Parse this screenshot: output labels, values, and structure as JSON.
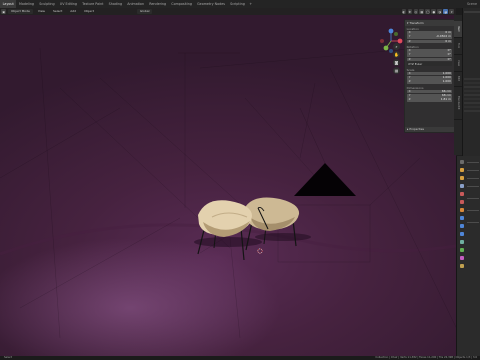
{
  "topbar": {
    "tabs": [
      "Layout",
      "Modeling",
      "Sculpting",
      "UV Editing",
      "Texture Paint",
      "Shading",
      "Animation",
      "Rendering",
      "Compositing",
      "Geometry Nodes",
      "Scripting"
    ],
    "active_tab": "Layout",
    "add_label": "+",
    "scene_label": "Scene"
  },
  "viewport_header": {
    "mode_select": "Object Mode",
    "view_menus": [
      "View",
      "Select",
      "Add",
      "Object"
    ],
    "transform_orientation": "Global"
  },
  "navigation": {
    "zoom_icon": "zoom-icon",
    "pan_icon": "hand-icon",
    "camera_icon": "camera-icon",
    "ortho_icon": "grid-icon",
    "gizmo_axes": {
      "x": "#e04a5c",
      "y": "#7db646",
      "z": "#4d86db"
    }
  },
  "npanel": {
    "title": "Transform",
    "location": {
      "label": "Location",
      "x": "0 m",
      "y": "-0.4502 m",
      "z": "0 m"
    },
    "rotation": {
      "label": "Rotation",
      "x": "0°",
      "y": "0°",
      "z": "0°"
    },
    "rotation_mode": "XYZ Euler",
    "scale": {
      "label": "Scale",
      "x": "1.000",
      "y": "1.000",
      "z": "1.000"
    },
    "dimensions": {
      "label": "Dimensions",
      "x": "66 cm",
      "y": "68 cm",
      "z": "1.81 m"
    },
    "axis_labels": [
      "X",
      "Y",
      "Z"
    ],
    "properties_label": "Properties"
  },
  "sidebar_tabs": [
    "Item",
    "Tool",
    "View",
    "Edit",
    "BlenderKit"
  ],
  "colors": {
    "accent": "#4772b3",
    "background_wall": "#46223f",
    "chair_fabric": "#d9c7a6",
    "chair_frame": "#151515"
  },
  "statusbar": {
    "left": "Select",
    "right": "Collection | Chair | Verts 11,382 | Faces 11,200 | Tris 22,398 | Objects 1/3 | 3.6"
  }
}
